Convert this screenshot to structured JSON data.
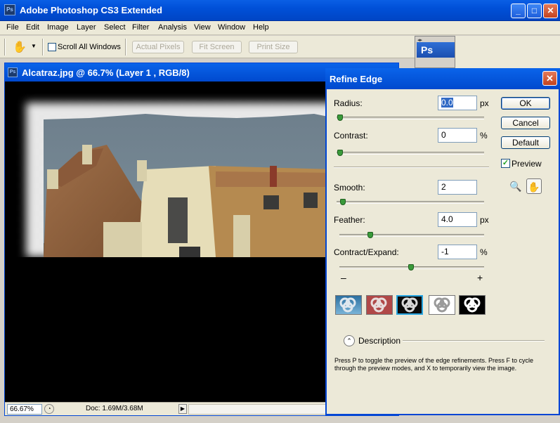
{
  "app": {
    "title": "Adobe Photoshop CS3 Extended",
    "icon_text": "Ps"
  },
  "menu": [
    "File",
    "Edit",
    "Image",
    "Layer",
    "Select",
    "Filter",
    "Analysis",
    "View",
    "Window",
    "Help"
  ],
  "options": {
    "scroll_all_label": "Scroll All Windows",
    "scroll_all_checked": false,
    "actual_pixels": "Actual Pixels",
    "fit_screen": "Fit Screen",
    "print_size": "Print Size"
  },
  "panel": {
    "ps_label": "Ps"
  },
  "document": {
    "title": "Alcatraz.jpg @ 66.7% (Layer 1 , RGB/8)",
    "zoom": "66.67%",
    "doc_size": "Doc: 1.69M/3.68M"
  },
  "dialog": {
    "title": "Refine Edge",
    "fields": [
      {
        "label": "Radius:",
        "value": "0.0",
        "unit": "px",
        "slider": 0.0
      },
      {
        "label": "Contrast:",
        "value": "0",
        "unit": "%",
        "slider": 0.0
      },
      {
        "label": "Smooth:",
        "value": "2",
        "unit": "",
        "slider": 0.02
      },
      {
        "label": "Feather:",
        "value": "4.0",
        "unit": "px",
        "slider": 0.2
      },
      {
        "label": "Contract/Expand:",
        "value": "-1",
        "unit": "%",
        "slider": 0.5
      }
    ],
    "minus": "–",
    "plus": "+",
    "buttons": {
      "ok": "OK",
      "cancel": "Cancel",
      "default": "Default"
    },
    "preview_label": "Preview",
    "preview_checked": true,
    "description_label": "Description",
    "description_text": "Press P to toggle the preview of the edge refinements. Press F to cycle through the preview modes, and X to temporarily view the image."
  }
}
